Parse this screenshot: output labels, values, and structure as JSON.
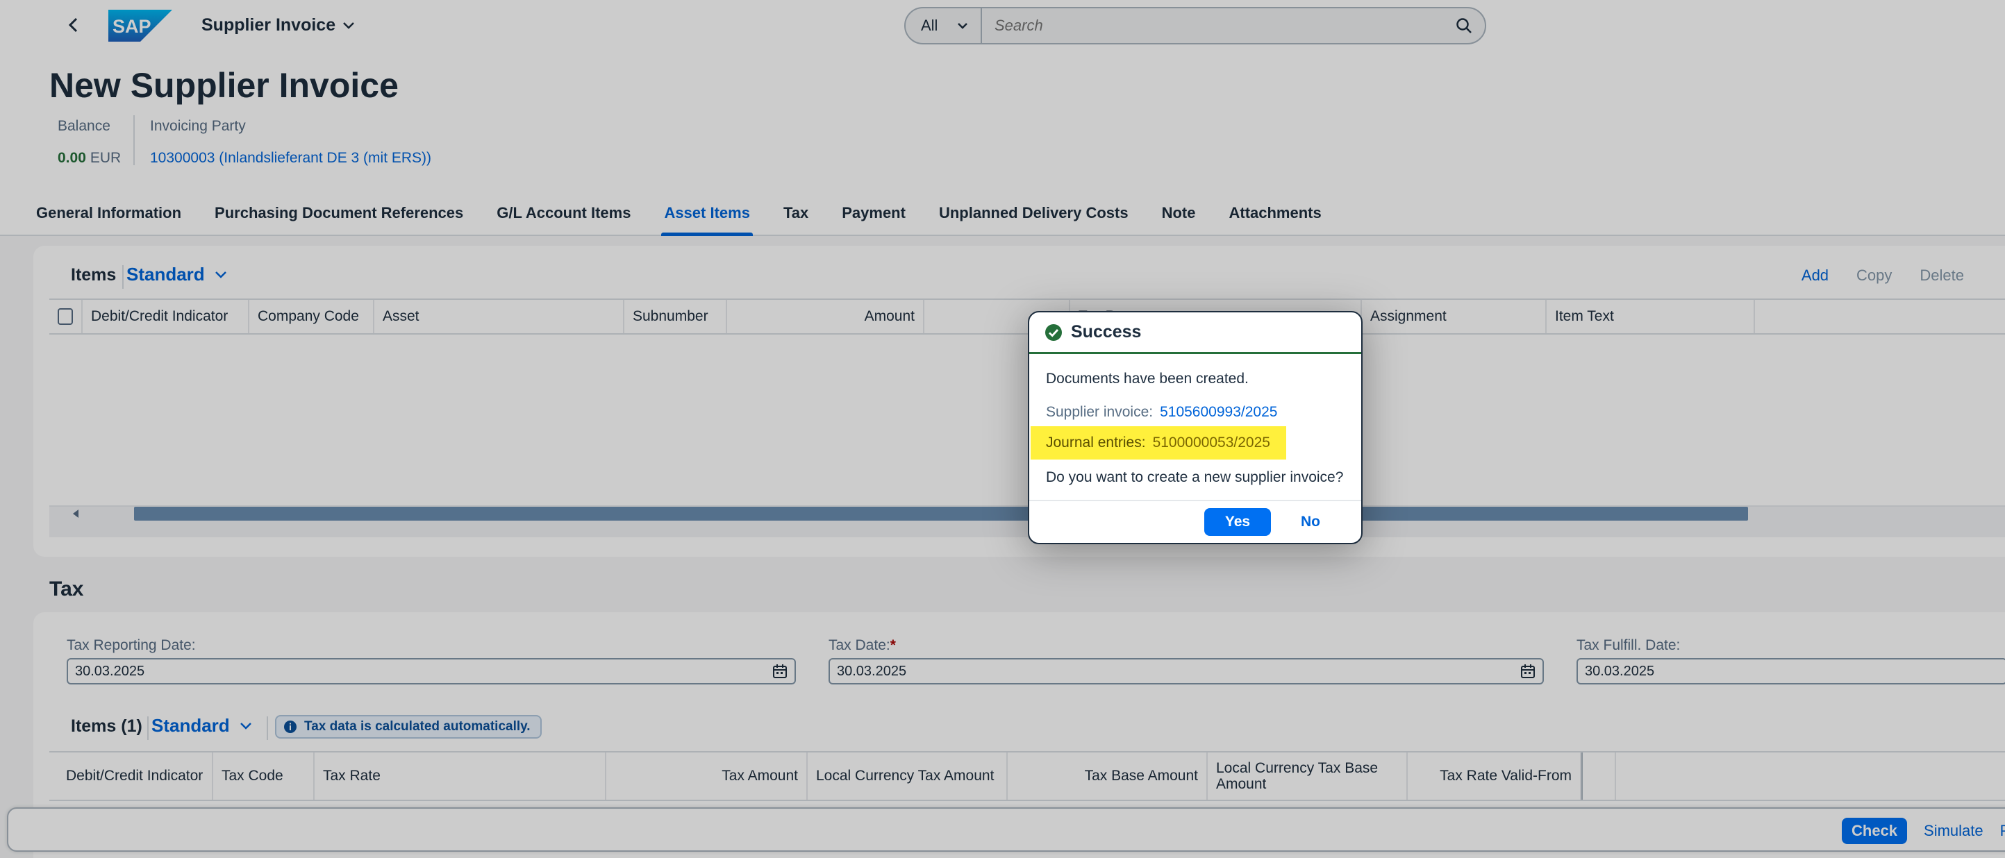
{
  "shell": {
    "app_title": "Supplier Invoice",
    "search_scope": "All",
    "search_placeholder": "Search"
  },
  "header": {
    "title": "New Supplier Invoice",
    "balance_label": "Balance",
    "balance_value": "0.00",
    "balance_currency": "EUR",
    "party_label": "Invoicing Party",
    "party_value": "10300003 (Inlandslieferant DE 3 (mit ERS))"
  },
  "tabs": [
    {
      "label": "General Information"
    },
    {
      "label": "Purchasing Document References"
    },
    {
      "label": "G/L Account Items"
    },
    {
      "label": "Asset Items"
    },
    {
      "label": "Tax"
    },
    {
      "label": "Payment"
    },
    {
      "label": "Unplanned Delivery Costs"
    },
    {
      "label": "Note"
    },
    {
      "label": "Attachments"
    }
  ],
  "items": {
    "title": "Items",
    "variant": "Standard",
    "actions": {
      "add": "Add",
      "copy": "Copy",
      "delete": "Delete"
    },
    "columns": [
      "Debit/Credit Indicator",
      "Company Code",
      "Asset",
      "Subnumber",
      "Amount",
      "Tax Rate",
      "Assignment",
      "Item Text"
    ]
  },
  "tax": {
    "title": "Tax",
    "reporting_date_label": "Tax Reporting Date:",
    "reporting_date_value": "30.03.2025",
    "tax_date_label": "Tax Date:",
    "tax_date_required": "*",
    "tax_date_value": "30.03.2025",
    "fulfill_date_label": "Tax Fulfill. Date:",
    "fulfill_date_value": "30.03.2025",
    "items_title": "Items (1)",
    "items_variant": "Standard",
    "info_text": "Tax data is calculated automatically.",
    "columns": [
      "Debit/Credit Indicator",
      "Tax Code",
      "Tax Rate",
      "Tax Amount",
      "Local Currency Tax Amount",
      "Tax Base Amount",
      "Local Currency Tax Base Amount",
      "Tax Rate Valid-From"
    ]
  },
  "footer": {
    "check": "Check",
    "simulate": "Simulate",
    "post": "Po"
  },
  "dialog": {
    "title": "Success",
    "message": "Documents have been created.",
    "supplier_invoice_label": "Supplier invoice:",
    "supplier_invoice_value": "5105600993/2025",
    "journal_label": "Journal entries:",
    "journal_value": "5100000053/2025",
    "question": "Do you want to create a new supplier invoice?",
    "yes": "Yes",
    "no": "No"
  },
  "colors": {
    "brand_blue": "#0070f2",
    "link_blue": "#0064d9",
    "success_green": "#256f3a",
    "highlight_yellow": "#fff03c"
  }
}
